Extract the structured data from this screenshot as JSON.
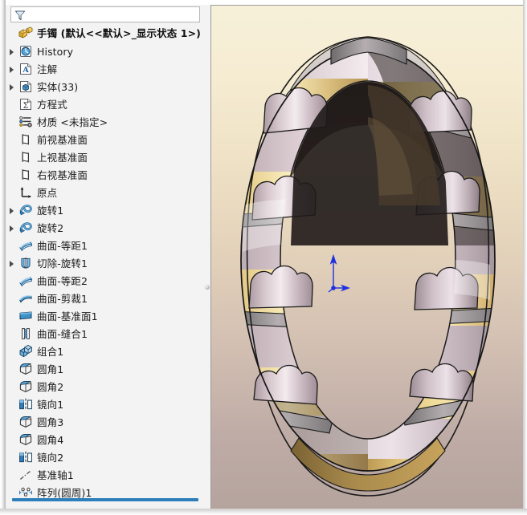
{
  "app": {
    "kind": "cad-feature-tree"
  },
  "filter": {
    "placeholder": "",
    "value": "",
    "icon": "filter-funnel-icon"
  },
  "tree": {
    "title": {
      "label": "手镯  (默认<<默认>_显示状态 1>)",
      "icon": "part-document-icon",
      "expandable": false
    },
    "items": [
      {
        "label": "History",
        "icon": "history-icon",
        "expandable": true,
        "indent": 0
      },
      {
        "label": "注解",
        "icon": "annotations-icon",
        "expandable": true,
        "indent": 0
      },
      {
        "label": "实体(33)",
        "icon": "solid-bodies-icon",
        "expandable": true,
        "indent": 0
      },
      {
        "label": "方程式",
        "icon": "equations-icon",
        "expandable": false,
        "indent": 0
      },
      {
        "label": "材质 <未指定>",
        "icon": "material-icon",
        "expandable": false,
        "indent": 0
      },
      {
        "label": "前视基准面",
        "icon": "plane-icon",
        "expandable": false,
        "indent": 0
      },
      {
        "label": "上视基准面",
        "icon": "plane-icon",
        "expandable": false,
        "indent": 0
      },
      {
        "label": "右视基准面",
        "icon": "plane-icon",
        "expandable": false,
        "indent": 0
      },
      {
        "label": "原点",
        "icon": "origin-icon",
        "expandable": false,
        "indent": 0
      },
      {
        "label": "旋转1",
        "icon": "revolve-icon",
        "expandable": true,
        "indent": 0
      },
      {
        "label": "旋转2",
        "icon": "revolve-icon",
        "expandable": true,
        "indent": 0
      },
      {
        "label": "曲面-等距1",
        "icon": "surface-offset-icon",
        "expandable": false,
        "indent": 0
      },
      {
        "label": "切除-旋转1",
        "icon": "revolve-cut-icon",
        "expandable": true,
        "indent": 0
      },
      {
        "label": "曲面-等距2",
        "icon": "surface-offset-icon",
        "expandable": false,
        "indent": 0
      },
      {
        "label": "曲面-剪裁1",
        "icon": "surface-trim-icon",
        "expandable": false,
        "indent": 0
      },
      {
        "label": "曲面-基准面1",
        "icon": "surface-plane-icon",
        "expandable": false,
        "indent": 0
      },
      {
        "label": "曲面-缝合1",
        "icon": "surface-knit-icon",
        "expandable": false,
        "indent": 0
      },
      {
        "label": "组合1",
        "icon": "combine-icon",
        "expandable": false,
        "indent": 0
      },
      {
        "label": "圆角1",
        "icon": "fillet-icon",
        "expandable": false,
        "indent": 0
      },
      {
        "label": "圆角2",
        "icon": "fillet-icon",
        "expandable": false,
        "indent": 0
      },
      {
        "label": "镜向1",
        "icon": "mirror-icon",
        "expandable": false,
        "indent": 0
      },
      {
        "label": "圆角3",
        "icon": "fillet-icon",
        "expandable": false,
        "indent": 0
      },
      {
        "label": "圆角4",
        "icon": "fillet-icon",
        "expandable": false,
        "indent": 0
      },
      {
        "label": "镜向2",
        "icon": "mirror-icon",
        "expandable": false,
        "indent": 0
      },
      {
        "label": "基准轴1",
        "icon": "axis-icon",
        "expandable": false,
        "indent": 0
      },
      {
        "label": "阵列(圆周)1",
        "icon": "circular-pattern-icon",
        "expandable": false,
        "indent": 0
      }
    ]
  },
  "viewport": {
    "model_name": "手镯",
    "triad_icon": "origin-triad-icon",
    "background_top_color": "#f7f0d9",
    "background_bottom_color": "#b5a39e",
    "gold_color": "#e0c27a",
    "gold_highlight_color": "#f7e9b0",
    "silver_color": "#c6b7bd",
    "silver_highlight_color": "#efe6ea",
    "edge_color": "#1a1a1a",
    "shadow_color": "#3a3230",
    "triad_color": "#1f30e0",
    "segment_count": 18
  },
  "rollback": {
    "color": "#2e7ebb"
  }
}
